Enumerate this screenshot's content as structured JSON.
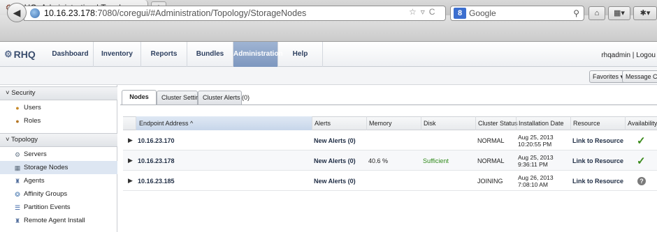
{
  "browser": {
    "tab_title": "RHQ: Administration | Topology...",
    "new_tab": "+",
    "url_host": "10.16.23.178",
    "url_path": ":7080/coregui/#Administration/Topology/StorageNodes",
    "search_placeholder": "Google",
    "search_engine_letter": "8"
  },
  "app": {
    "logo_text": "RHQ",
    "menu": [
      "Dashboard",
      "Inventory",
      "Reports",
      "Bundles",
      "Administration",
      "Help"
    ],
    "active_menu": "Administration",
    "user": "rhqadmin | Logou",
    "favorites": "Favorites ▾",
    "message_center": "Message Cente"
  },
  "sidebar": {
    "sections": [
      {
        "title": "Security",
        "items": [
          {
            "label": "Users",
            "icon": "user-icon"
          },
          {
            "label": "Roles",
            "icon": "roles-icon"
          }
        ]
      },
      {
        "title": "Topology",
        "items": [
          {
            "label": "Servers",
            "icon": "servers-icon"
          },
          {
            "label": "Storage Nodes",
            "icon": "storage-icon"
          },
          {
            "label": "Agents",
            "icon": "agent-icon"
          },
          {
            "label": "Affinity Groups",
            "icon": "affinity-icon"
          },
          {
            "label": "Partition Events",
            "icon": "partition-icon"
          },
          {
            "label": "Remote Agent Install",
            "icon": "agent-install-icon"
          }
        ]
      }
    ],
    "selected": "Storage Nodes"
  },
  "tabs": [
    "Nodes",
    "Cluster Settings",
    "Cluster Alerts (0)"
  ],
  "active_tab": "Nodes",
  "table": {
    "columns": [
      "Endpoint Address ^",
      "Alerts",
      "Memory",
      "Disk",
      "Cluster Status",
      "Installation Date",
      "Resource",
      "Availability"
    ],
    "rows": [
      {
        "endpoint": "10.16.23.170",
        "alerts": "New Alerts (0)",
        "memory": "",
        "disk": "",
        "status": "NORMAL",
        "date": "Aug 25, 2013 10:20:55 PM",
        "resource": "Link to Resource",
        "availability": "up"
      },
      {
        "endpoint": "10.16.23.178",
        "alerts": "New Alerts (0)",
        "memory": "40.6 %",
        "disk": "Sufficient",
        "status": "NORMAL",
        "date": "Aug 25, 2013 9:36:11 PM",
        "resource": "Link to Resource",
        "availability": "up"
      },
      {
        "endpoint": "10.16.23.185",
        "alerts": "New Alerts (0)",
        "memory": "",
        "disk": "",
        "status": "JOINING",
        "date": "Aug 26, 2013 7:08:10 AM",
        "resource": "Link to Resource",
        "availability": "unknown"
      }
    ]
  },
  "colors": {
    "active_menu": "#7d97bf",
    "ok": "#3a8a1a",
    "disk_ok": "#2f8a1a"
  }
}
